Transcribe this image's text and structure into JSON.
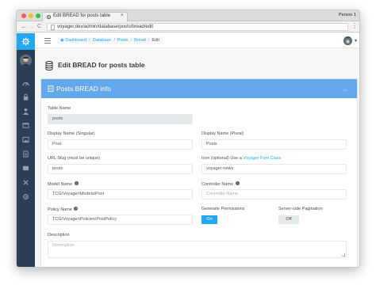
{
  "browser": {
    "tab_title": "Edit BREAD for posts table",
    "tab_close": "×",
    "profile": "Person 1",
    "url": "voyager.dev/admin/database/posts/bread/edit",
    "back": "←",
    "forward": "→",
    "reload": "C",
    "menu": "⋮"
  },
  "breadcrumbs": {
    "items": [
      "Dashboard",
      "Database",
      "Posts",
      "Bread"
    ],
    "current": "Edit",
    "separator": "/"
  },
  "user_menu": {
    "caret": "▾"
  },
  "page": {
    "title": "Edit BREAD for posts table"
  },
  "panel": {
    "title": "Posts BREAD info",
    "caret": "︿"
  },
  "form": {
    "table_name": {
      "label": "Table Name",
      "value": "posts"
    },
    "display_singular": {
      "label": "Display Name (Singular)",
      "value": "Post"
    },
    "display_plural": {
      "label": "Display Name (Plural)",
      "value": "Posts"
    },
    "url_slug": {
      "label": "URL Slug (must be unique)",
      "value": "posts"
    },
    "icon": {
      "label_prefix": "Icon (optional) Use a",
      "label_link": "Voyager Font Class",
      "value": "voyager-news"
    },
    "model_name": {
      "label": "Model Name",
      "value": "TCG\\Voyager\\Models\\Post"
    },
    "controller_name": {
      "label": "Controller Name",
      "placeholder": "Controller Name"
    },
    "policy_name": {
      "label": "Policy Name",
      "value": "TCG\\Voyager\\Policies\\PostPolicy"
    },
    "generate_permissions": {
      "label": "Generate Permissions",
      "state": "On"
    },
    "server_side_pagination": {
      "label": "Server-side Pagination",
      "state": "Off"
    },
    "description": {
      "label": "Description",
      "placeholder": "Description"
    },
    "help_glyph": "?"
  },
  "colors": {
    "accent": "#22a7f0",
    "sidebar": "#2a3f54",
    "panel_header": "#62a8ea"
  },
  "icons": {
    "sidebar": [
      "dashboard-icon",
      "lock-icon",
      "person-icon",
      "browser-icon",
      "image-icon",
      "document-icon",
      "categories-icon",
      "tools-icon",
      "settings-icon"
    ]
  }
}
